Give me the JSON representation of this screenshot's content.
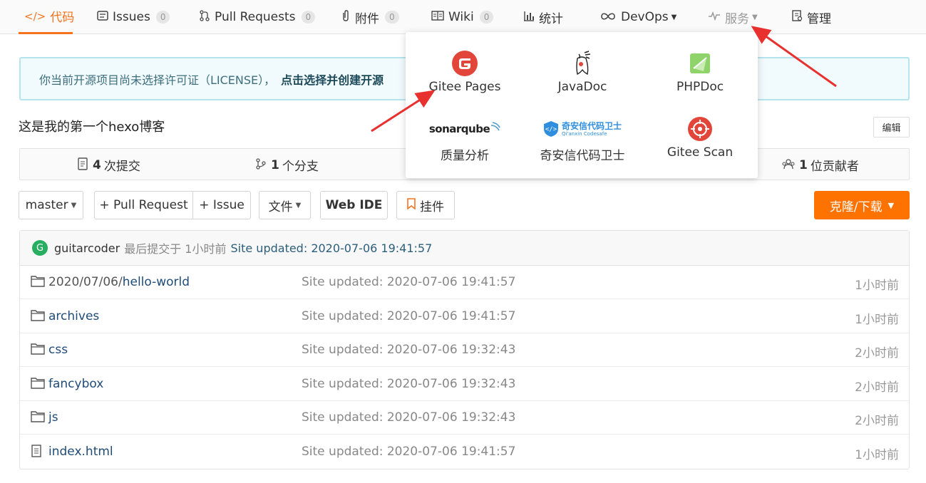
{
  "nav": {
    "tabs": [
      {
        "label": "代码",
        "icon": "code-icon",
        "active": true
      },
      {
        "label": "Issues",
        "icon": "issues-icon",
        "count": "0"
      },
      {
        "label": "Pull Requests",
        "icon": "pull-request-icon",
        "count": "0"
      },
      {
        "label": "附件",
        "icon": "attachment-icon",
        "count": "0"
      },
      {
        "label": "Wiki",
        "icon": "wiki-icon",
        "count": "0"
      },
      {
        "label": "统计",
        "icon": "chart-icon"
      },
      {
        "label": "DevOps",
        "icon": "infinity-icon"
      },
      {
        "label": "服务",
        "icon": "pulse-icon"
      },
      {
        "label": "管理",
        "icon": "manage-icon"
      }
    ]
  },
  "license": {
    "text": "你当前开源项目尚未选择许可证（LICENSE），",
    "link": "点击选择并创建开源"
  },
  "repo": {
    "description": "这是我的第一个hexo博客",
    "edit_label": "编辑"
  },
  "stats": {
    "commits_num": "4",
    "commits_label": "次提交",
    "branches_num": "1",
    "branches_label": "个分支",
    "contributors_num": "1",
    "contributors_label": "位贡献者"
  },
  "toolbar": {
    "branch": "master",
    "pull_request": "+ Pull Request",
    "issue": "+ Issue",
    "file": "文件",
    "web_ide": "Web IDE",
    "widget": "挂件",
    "clone": "克隆/下载"
  },
  "commit": {
    "avatar_letter": "G",
    "author": "guitarcoder",
    "meta": "最后提交于 1小时前",
    "message": "Site updated: 2020-07-06 19:41:57"
  },
  "files": [
    {
      "prefix": "2020/07/06/",
      "name": "hello-world",
      "type": "folder",
      "message": "Site updated: 2020-07-06 19:41:57",
      "time": "1小时前"
    },
    {
      "prefix": "",
      "name": "archives",
      "type": "folder",
      "message": "Site updated: 2020-07-06 19:41:57",
      "time": "1小时前"
    },
    {
      "prefix": "",
      "name": "css",
      "type": "folder",
      "message": "Site updated: 2020-07-06 19:32:43",
      "time": "2小时前"
    },
    {
      "prefix": "",
      "name": "fancybox",
      "type": "folder",
      "message": "Site updated: 2020-07-06 19:32:43",
      "time": "2小时前"
    },
    {
      "prefix": "",
      "name": "js",
      "type": "folder",
      "message": "Site updated: 2020-07-06 19:32:43",
      "time": "2小时前"
    },
    {
      "prefix": "",
      "name": "index.html",
      "type": "file",
      "message": "Site updated: 2020-07-06 19:41:57",
      "time": "1小时前"
    }
  ],
  "services": {
    "items": [
      {
        "label": "Gitee Pages",
        "icon": "gitee-pages-icon"
      },
      {
        "label": "JavaDoc",
        "icon": "javadoc-icon"
      },
      {
        "label": "PHPDoc",
        "icon": "phpdoc-icon"
      },
      {
        "label": "质量分析",
        "icon": "sonarqube-icon",
        "logo_text": "sonarqube"
      },
      {
        "label": "奇安信代码卫士",
        "icon": "qianxin-icon",
        "logo_text": "奇安信代码卫士",
        "logo_sub": "Qi'anxin Codesafe"
      },
      {
        "label": "Gitee Scan",
        "icon": "gitee-scan-icon"
      }
    ]
  },
  "colors": {
    "accent": "#f5731f",
    "clone": "#fe7300",
    "arrow": "#e8302e",
    "gitee_red": "#e2463a",
    "phpdoc_green": "#8fd36b"
  }
}
